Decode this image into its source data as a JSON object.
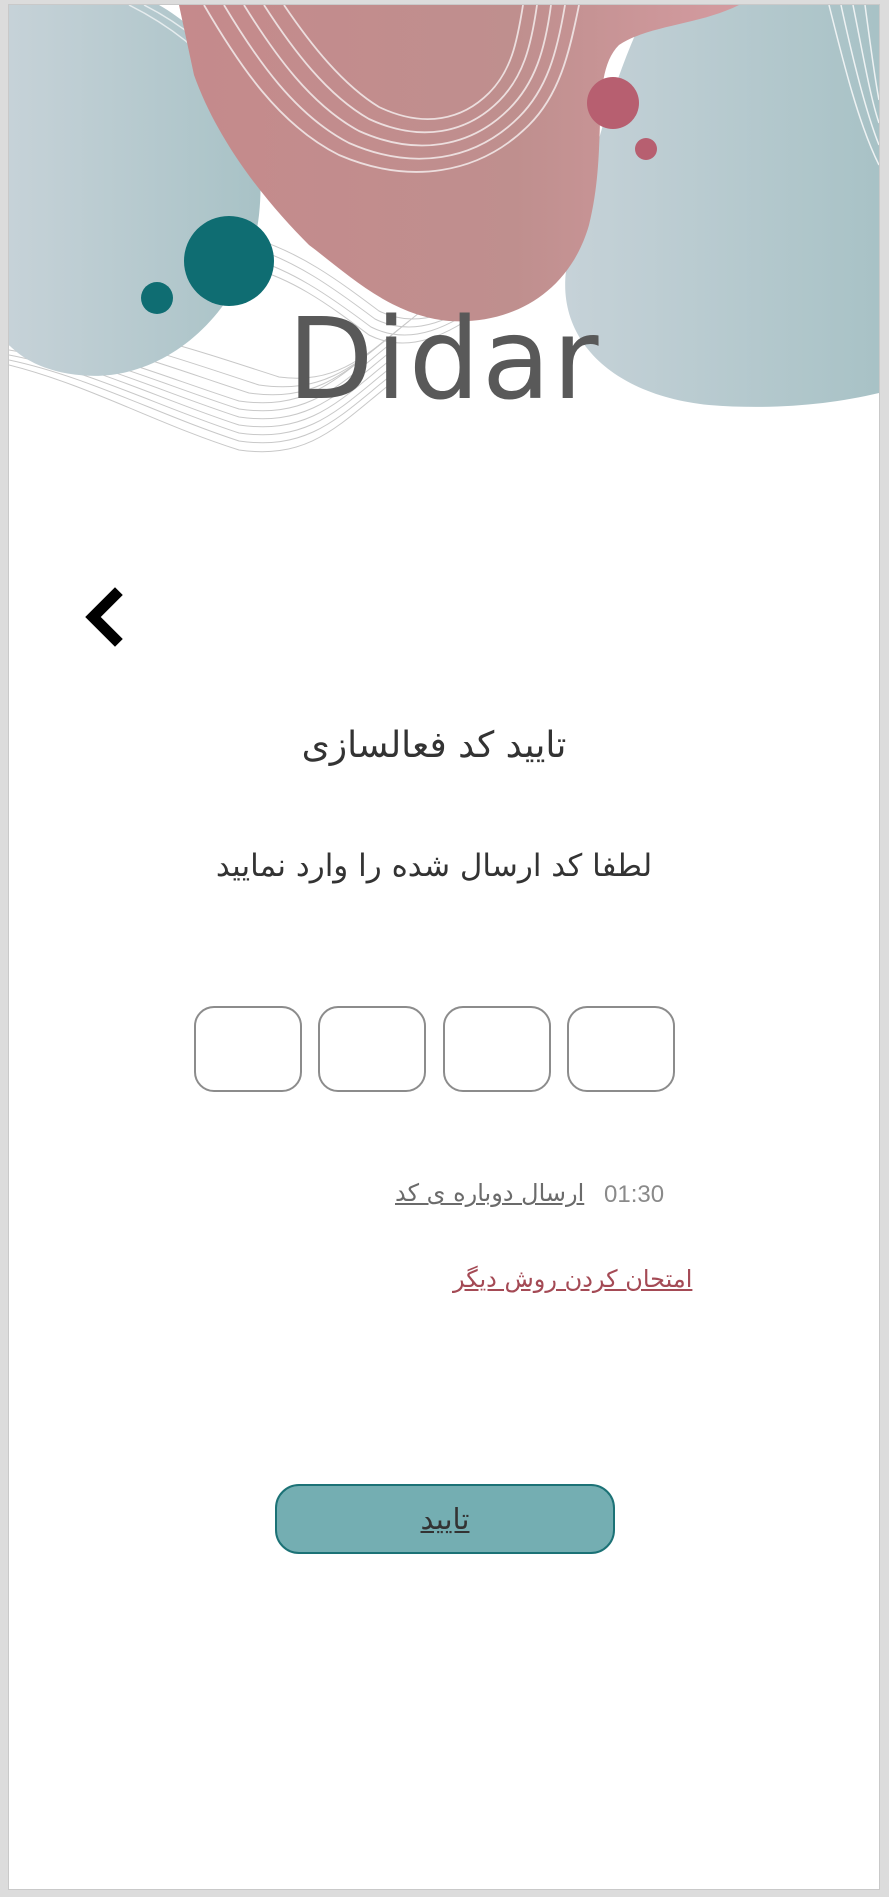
{
  "app": {
    "title": "Didar"
  },
  "colors": {
    "accent_teal": "#1c7276",
    "button_fill": "#74aeb2",
    "link_red": "#a44a55",
    "blob_blue": "#b3c6cc",
    "blob_pink": "#c98c90"
  },
  "header": {
    "back_icon": "chevron-left-icon"
  },
  "verify": {
    "heading": "تایید کد فعالسازی",
    "instruction": "لطفا کد ارسال شده را وارد نمایید",
    "otp_boxes": [
      "",
      "",
      "",
      ""
    ],
    "timer": "01:30",
    "resend_label": "ارسال دوباره ی کد",
    "alt_method_label": "امتحان کردن روش دیگر",
    "confirm_label": "تایید"
  }
}
